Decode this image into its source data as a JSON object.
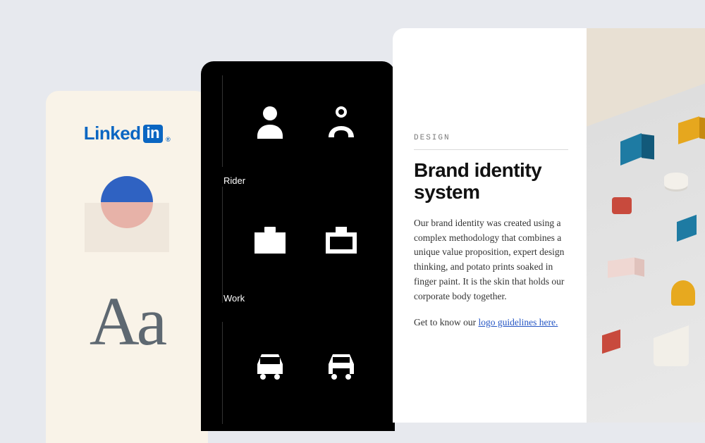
{
  "card1": {
    "logo_text": "Linked",
    "logo_badge": "in",
    "registered": "®",
    "type_sample": "Aa"
  },
  "card2": {
    "section_rider": "Rider",
    "section_work": "Work"
  },
  "card3": {
    "eyebrow": "DESIGN",
    "title": "Brand identity system",
    "body": "Our brand identity was created using a complex methodology that combines a unique value proposition, expert design thinking, and potato prints soaked in finger paint. It is the skin that holds our corporate body together.",
    "cta_prefix": "Get to know our ",
    "cta_link": "logo guidelines here."
  }
}
